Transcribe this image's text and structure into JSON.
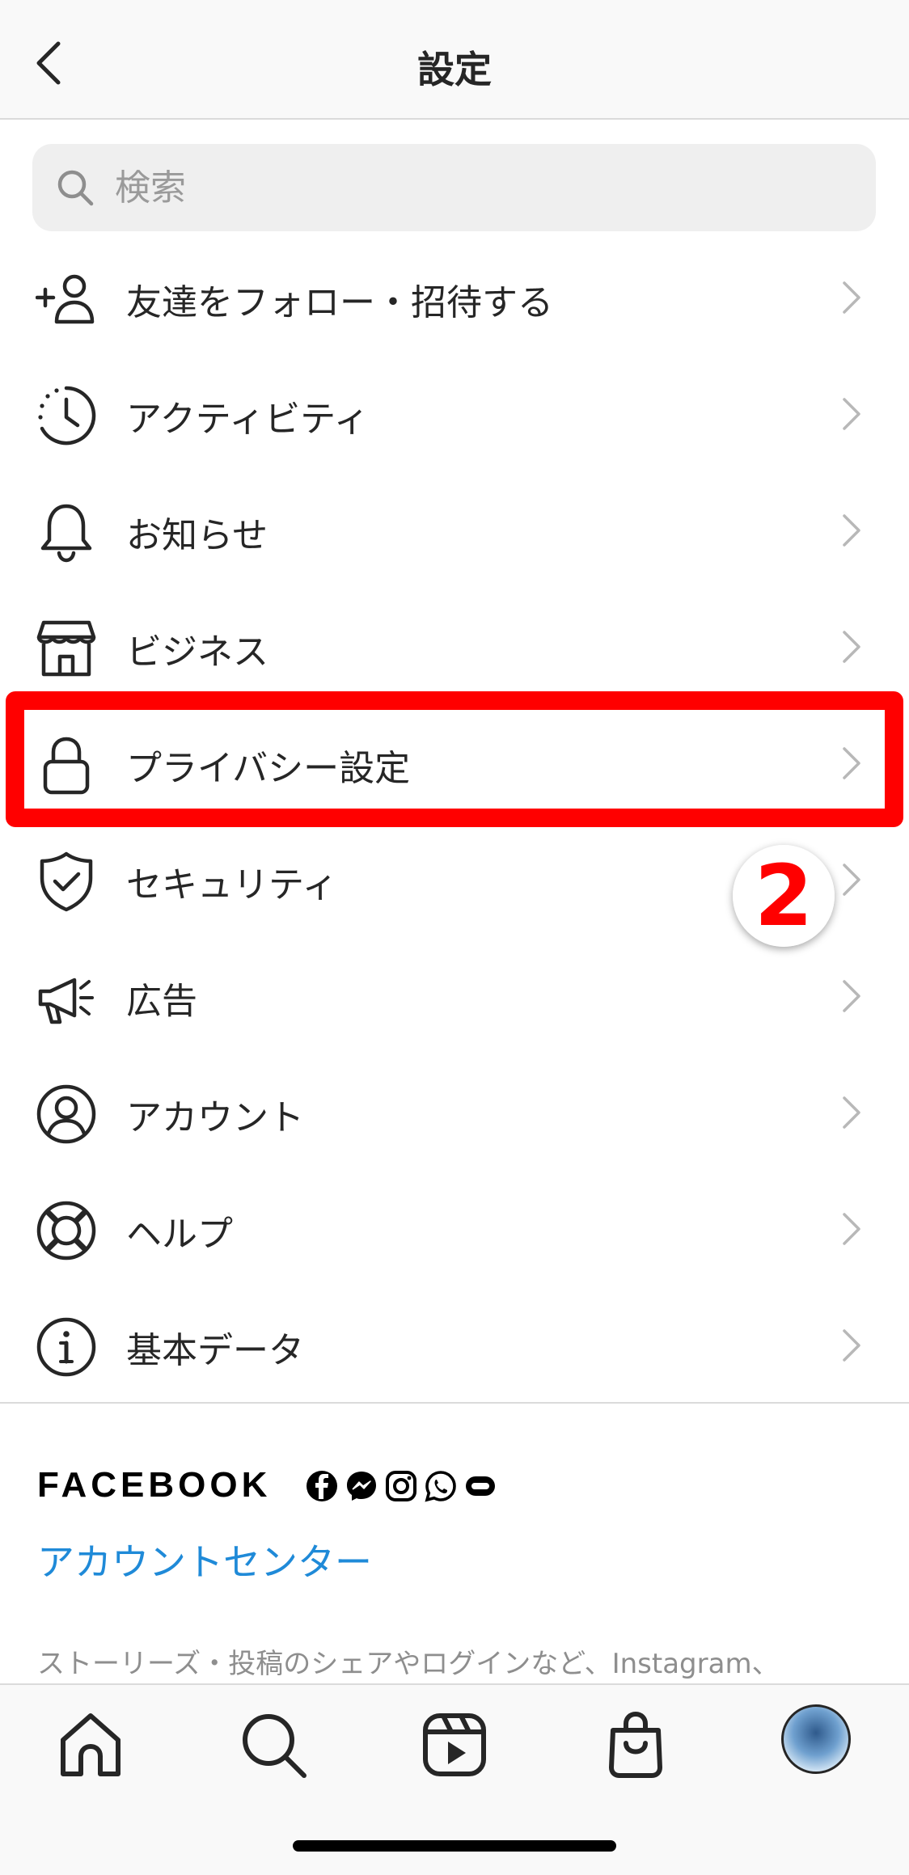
{
  "header": {
    "title": "設定"
  },
  "search": {
    "placeholder": "検索"
  },
  "menu": {
    "items": [
      {
        "label": "友達をフォロー・招待する",
        "icon": "add-person-icon"
      },
      {
        "label": "アクティビティ",
        "icon": "activity-clock-icon"
      },
      {
        "label": "お知らせ",
        "icon": "bell-icon"
      },
      {
        "label": "ビジネス",
        "icon": "shop-icon"
      },
      {
        "label": "プライバシー設定",
        "icon": "lock-icon"
      },
      {
        "label": "セキュリティ",
        "icon": "shield-check-icon"
      },
      {
        "label": "広告",
        "icon": "megaphone-icon"
      },
      {
        "label": "アカウント",
        "icon": "account-circle-icon"
      },
      {
        "label": "ヘルプ",
        "icon": "lifebuoy-icon"
      },
      {
        "label": "基本データ",
        "icon": "info-icon"
      }
    ]
  },
  "annotation": {
    "step": "2",
    "highlight_color": "#ff0000"
  },
  "facebook": {
    "title": "FACEBOOK",
    "link": "アカウントセンター",
    "description": "ストーリーズ・投稿のシェアやログインなど、Instagram、",
    "link_color": "#1f8ad8"
  },
  "bottom_nav": {
    "items": [
      "home-icon",
      "search-icon",
      "reels-icon",
      "shop-bag-icon",
      "profile-avatar"
    ]
  }
}
